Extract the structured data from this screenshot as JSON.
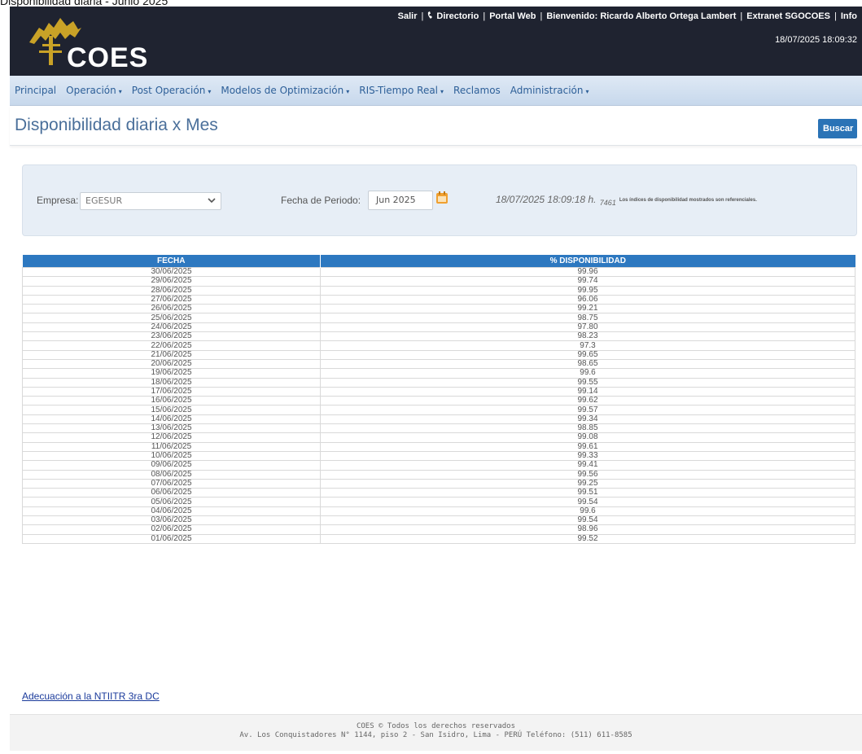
{
  "caption": "Disponibilidad diaria - Junio 2025",
  "header": {
    "logo_text": "COES",
    "links": [
      "Salir",
      "Directorio",
      "Portal Web",
      "Bienvenido: Ricardo Alberto Ortega Lambert",
      "Extranet SGOCOES",
      "Info"
    ],
    "datetime": "18/07/2025 18:09:32"
  },
  "menu": {
    "items": [
      "Principal",
      "Operación",
      "Post Operación",
      "Modelos de Optimización",
      "RIS-Tiempo Real",
      "Reclamos",
      "Administración"
    ],
    "caret": "▾"
  },
  "page": {
    "title": "Disponibilidad diaria x Mes",
    "search_button": "Buscar"
  },
  "filters": {
    "empresa_label": "Empresa:",
    "empresa_value": "EGESUR",
    "periodo_label": "Fecha de Periodo:",
    "periodo_value": "Jun 2025",
    "timestamp": "18/07/2025 18:09:18 h.",
    "code": "7461",
    "note": "Los índices de disponibilidad mostrados son referenciales."
  },
  "table": {
    "headers": [
      "FECHA",
      "% DISPONIBILIDAD"
    ],
    "rows": [
      [
        "30/06/2025",
        "99.96"
      ],
      [
        "29/06/2025",
        "99.74"
      ],
      [
        "28/06/2025",
        "99.95"
      ],
      [
        "27/06/2025",
        "96.06"
      ],
      [
        "26/06/2025",
        "99.21"
      ],
      [
        "25/06/2025",
        "98.75"
      ],
      [
        "24/06/2025",
        "97.80"
      ],
      [
        "23/06/2025",
        "98.23"
      ],
      [
        "22/06/2025",
        "97.3"
      ],
      [
        "21/06/2025",
        "99.65"
      ],
      [
        "20/06/2025",
        "98.65"
      ],
      [
        "19/06/2025",
        "99.6"
      ],
      [
        "18/06/2025",
        "99.55"
      ],
      [
        "17/06/2025",
        "99.14"
      ],
      [
        "16/06/2025",
        "99.62"
      ],
      [
        "15/06/2025",
        "99.57"
      ],
      [
        "14/06/2025",
        "99.34"
      ],
      [
        "13/06/2025",
        "98.85"
      ],
      [
        "12/06/2025",
        "99.08"
      ],
      [
        "11/06/2025",
        "99.61"
      ],
      [
        "10/06/2025",
        "99.33"
      ],
      [
        "09/06/2025",
        "99.41"
      ],
      [
        "08/06/2025",
        "99.56"
      ],
      [
        "07/06/2025",
        "99.25"
      ],
      [
        "06/06/2025",
        "99.51"
      ],
      [
        "05/06/2025",
        "99.54"
      ],
      [
        "04/06/2025",
        "99.6"
      ],
      [
        "03/06/2025",
        "99.54"
      ],
      [
        "02/06/2025",
        "98.96"
      ],
      [
        "01/06/2025",
        "99.52"
      ]
    ]
  },
  "footer": {
    "link": "Adecuación a la NTIITR 3ra DC",
    "line1": "COES © Todos los derechos reservados",
    "line2": "Av. Los Conquistadores N° 1144, piso 2 - San Isidro, Lima - PERÚ Teléfono: (511) 611-8585"
  },
  "colors": {
    "header_bg": "#1f2330",
    "menu_text": "#2d5f98",
    "table_header": "#2d78c0",
    "button": "#2a73b6"
  }
}
